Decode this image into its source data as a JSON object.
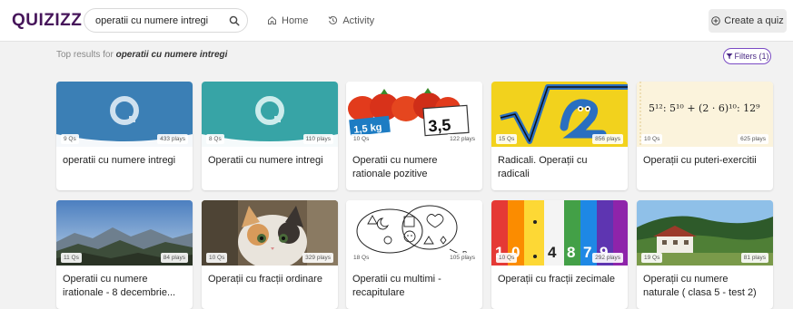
{
  "header": {
    "logo": "QUIZIZZ",
    "search_value": "operatii cu numere intregi",
    "nav": {
      "home": "Home",
      "activity": "Activity"
    },
    "create_label": "Create a quiz"
  },
  "results": {
    "prefix": "Top results for ",
    "query": "operatii cu numere intregi",
    "filters_label": "Filters (1)"
  },
  "cards": [
    {
      "title": "operatii cu numere intregi",
      "questions": "9 Qs",
      "plays": "433 plays",
      "thumb": "quizizz-blue"
    },
    {
      "title": "Operatii cu numere intregi",
      "questions": "8 Qs",
      "plays": "110 plays",
      "thumb": "quizizz-teal"
    },
    {
      "title": "Operatii cu numere rationale pozitive",
      "questions": "10 Qs",
      "plays": "122 plays",
      "thumb": "tomatoes-price-tag"
    },
    {
      "title": "Radicali. Operații cu radicali",
      "questions": "15 Qs",
      "plays": "856 plays",
      "thumb": "radical-cartoon"
    },
    {
      "title": "Operații cu puteri-exercitii",
      "questions": "10 Qs",
      "plays": "625 plays",
      "thumb": "powers-formula",
      "thumb_text": "5¹²: 5¹⁰ + (2 · 6)¹⁰: 12⁹"
    },
    {
      "title": "Operatii cu numere irationale - 8 decembrie...",
      "questions": "11 Qs",
      "plays": "84 plays",
      "thumb": "mountain-landscape"
    },
    {
      "title": "Operații cu fracții ordinare",
      "questions": "10 Qs",
      "plays": "329 plays",
      "thumb": "kitten-photo"
    },
    {
      "title": "Operatii cu multimi - recapitulare",
      "questions": "18 Qs",
      "plays": "105 plays",
      "thumb": "set-diagram",
      "thumb_label_b": "B"
    },
    {
      "title": "Operații cu fracții zecimale",
      "questions": "10 Qs",
      "plays": "292 plays",
      "thumb": "decimal-columns",
      "thumb_digits": [
        "1",
        "0",
        "4",
        "8",
        "7",
        "9"
      ]
    },
    {
      "title": "Operații cu numere naturale ( clasa 5 - test 2)",
      "questions": "19 Qs",
      "plays": "81 plays",
      "thumb": "hotel-hills"
    }
  ],
  "colors": {
    "brand": "#46155a",
    "quizizz_blue": "#3b7fb5",
    "quizizz_teal": "#37a4a6",
    "filter_accent": "#7a4bc4"
  }
}
